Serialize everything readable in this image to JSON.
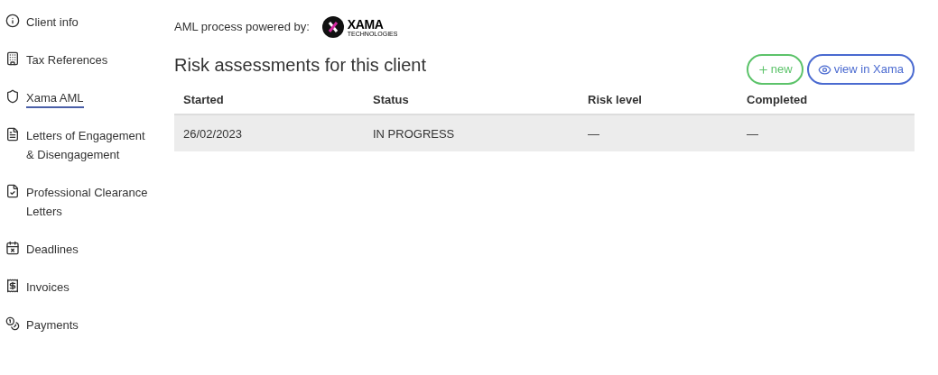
{
  "sidebar": {
    "items": [
      {
        "label": "Client info",
        "kind": "info",
        "selected": false
      },
      {
        "label": "Tax References",
        "kind": "building",
        "selected": false
      },
      {
        "label": "Xama AML",
        "kind": "shield",
        "selected": true
      },
      {
        "label": "Letters of Engagement & Disengagement",
        "kind": "document",
        "selected": false
      },
      {
        "label": "Professional Clearance Letters",
        "kind": "check-document",
        "selected": false
      },
      {
        "label": "Deadlines",
        "kind": "calendar",
        "selected": false
      },
      {
        "label": "Invoices",
        "kind": "invoice",
        "selected": false
      },
      {
        "label": "Payments",
        "kind": "coins",
        "selected": false
      }
    ]
  },
  "powered_by": {
    "label": "AML process powered by:",
    "logo_name": "XAMA",
    "logo_subtitle": "TECHNOLOGIES"
  },
  "title": "Risk assessments for this client",
  "buttons": [
    {
      "label": "new",
      "kind": "new"
    },
    {
      "label": "view in Xama",
      "kind": "view"
    }
  ],
  "table": {
    "columns": [
      "Started",
      "Status",
      "Risk level",
      "Completed"
    ],
    "rows": [
      [
        "26/02/2023",
        "IN PROGRESS",
        "—",
        "—"
      ]
    ]
  }
}
